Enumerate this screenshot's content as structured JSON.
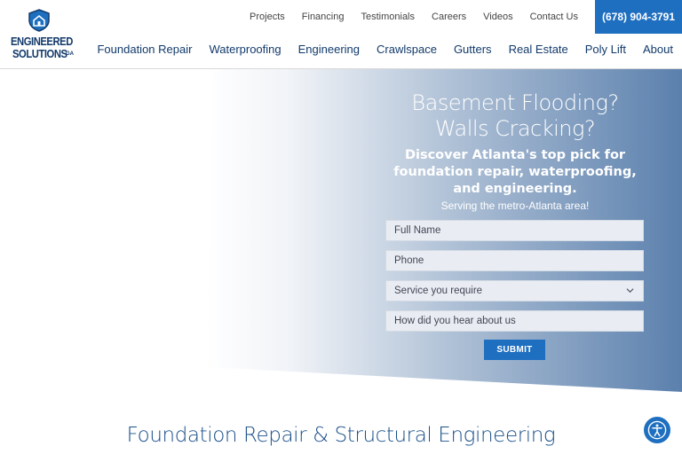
{
  "brand": {
    "line1": "ENGINEERED",
    "line2": "SOLUTIONS",
    "suffix": "GA"
  },
  "topnav": {
    "items": [
      "Projects",
      "Financing",
      "Testimonials",
      "Careers",
      "Videos",
      "Contact Us"
    ],
    "phone": "(678) 904-3791"
  },
  "mainnav": {
    "items": [
      "Foundation Repair",
      "Waterproofing",
      "Engineering",
      "Crawlspace",
      "Gutters",
      "Real Estate",
      "Poly Lift",
      "About"
    ]
  },
  "hero": {
    "headline_line1": "Basement Flooding?",
    "headline_line2": "Walls Cracking?",
    "sub_line1": "Discover Atlanta's top pick for",
    "sub_line2": "foundation repair, waterproofing,",
    "sub_line3": "and engineering.",
    "small": "Serving the metro-Atlanta area!"
  },
  "form": {
    "full_name_placeholder": "Full Name",
    "phone_placeholder": "Phone",
    "service_selected": "Service you require",
    "referral_placeholder": "How did you hear about us",
    "submit_label": "SUBMIT"
  },
  "section": {
    "title": "Foundation Repair & Structural Engineering"
  },
  "colors": {
    "brand_blue": "#1e6fc0",
    "navy": "#123a6b",
    "hero_gradient_end": "#5b80ad"
  },
  "icons": {
    "logo": "house-shield-icon",
    "dropdown": "chevron-down-icon",
    "accessibility": "accessibility-icon"
  }
}
